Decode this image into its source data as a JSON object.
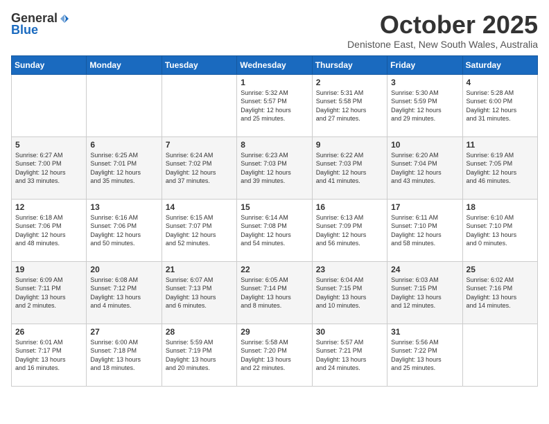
{
  "logo": {
    "general": "General",
    "blue": "Blue"
  },
  "title": "October 2025",
  "subtitle": "Denistone East, New South Wales, Australia",
  "days_of_week": [
    "Sunday",
    "Monday",
    "Tuesday",
    "Wednesday",
    "Thursday",
    "Friday",
    "Saturday"
  ],
  "weeks": [
    [
      {
        "day": "",
        "info": ""
      },
      {
        "day": "",
        "info": ""
      },
      {
        "day": "",
        "info": ""
      },
      {
        "day": "1",
        "info": "Sunrise: 5:32 AM\nSunset: 5:57 PM\nDaylight: 12 hours\nand 25 minutes."
      },
      {
        "day": "2",
        "info": "Sunrise: 5:31 AM\nSunset: 5:58 PM\nDaylight: 12 hours\nand 27 minutes."
      },
      {
        "day": "3",
        "info": "Sunrise: 5:30 AM\nSunset: 5:59 PM\nDaylight: 12 hours\nand 29 minutes."
      },
      {
        "day": "4",
        "info": "Sunrise: 5:28 AM\nSunset: 6:00 PM\nDaylight: 12 hours\nand 31 minutes."
      }
    ],
    [
      {
        "day": "5",
        "info": "Sunrise: 6:27 AM\nSunset: 7:00 PM\nDaylight: 12 hours\nand 33 minutes."
      },
      {
        "day": "6",
        "info": "Sunrise: 6:25 AM\nSunset: 7:01 PM\nDaylight: 12 hours\nand 35 minutes."
      },
      {
        "day": "7",
        "info": "Sunrise: 6:24 AM\nSunset: 7:02 PM\nDaylight: 12 hours\nand 37 minutes."
      },
      {
        "day": "8",
        "info": "Sunrise: 6:23 AM\nSunset: 7:03 PM\nDaylight: 12 hours\nand 39 minutes."
      },
      {
        "day": "9",
        "info": "Sunrise: 6:22 AM\nSunset: 7:03 PM\nDaylight: 12 hours\nand 41 minutes."
      },
      {
        "day": "10",
        "info": "Sunrise: 6:20 AM\nSunset: 7:04 PM\nDaylight: 12 hours\nand 43 minutes."
      },
      {
        "day": "11",
        "info": "Sunrise: 6:19 AM\nSunset: 7:05 PM\nDaylight: 12 hours\nand 46 minutes."
      }
    ],
    [
      {
        "day": "12",
        "info": "Sunrise: 6:18 AM\nSunset: 7:06 PM\nDaylight: 12 hours\nand 48 minutes."
      },
      {
        "day": "13",
        "info": "Sunrise: 6:16 AM\nSunset: 7:06 PM\nDaylight: 12 hours\nand 50 minutes."
      },
      {
        "day": "14",
        "info": "Sunrise: 6:15 AM\nSunset: 7:07 PM\nDaylight: 12 hours\nand 52 minutes."
      },
      {
        "day": "15",
        "info": "Sunrise: 6:14 AM\nSunset: 7:08 PM\nDaylight: 12 hours\nand 54 minutes."
      },
      {
        "day": "16",
        "info": "Sunrise: 6:13 AM\nSunset: 7:09 PM\nDaylight: 12 hours\nand 56 minutes."
      },
      {
        "day": "17",
        "info": "Sunrise: 6:11 AM\nSunset: 7:10 PM\nDaylight: 12 hours\nand 58 minutes."
      },
      {
        "day": "18",
        "info": "Sunrise: 6:10 AM\nSunset: 7:10 PM\nDaylight: 13 hours\nand 0 minutes."
      }
    ],
    [
      {
        "day": "19",
        "info": "Sunrise: 6:09 AM\nSunset: 7:11 PM\nDaylight: 13 hours\nand 2 minutes."
      },
      {
        "day": "20",
        "info": "Sunrise: 6:08 AM\nSunset: 7:12 PM\nDaylight: 13 hours\nand 4 minutes."
      },
      {
        "day": "21",
        "info": "Sunrise: 6:07 AM\nSunset: 7:13 PM\nDaylight: 13 hours\nand 6 minutes."
      },
      {
        "day": "22",
        "info": "Sunrise: 6:05 AM\nSunset: 7:14 PM\nDaylight: 13 hours\nand 8 minutes."
      },
      {
        "day": "23",
        "info": "Sunrise: 6:04 AM\nSunset: 7:15 PM\nDaylight: 13 hours\nand 10 minutes."
      },
      {
        "day": "24",
        "info": "Sunrise: 6:03 AM\nSunset: 7:15 PM\nDaylight: 13 hours\nand 12 minutes."
      },
      {
        "day": "25",
        "info": "Sunrise: 6:02 AM\nSunset: 7:16 PM\nDaylight: 13 hours\nand 14 minutes."
      }
    ],
    [
      {
        "day": "26",
        "info": "Sunrise: 6:01 AM\nSunset: 7:17 PM\nDaylight: 13 hours\nand 16 minutes."
      },
      {
        "day": "27",
        "info": "Sunrise: 6:00 AM\nSunset: 7:18 PM\nDaylight: 13 hours\nand 18 minutes."
      },
      {
        "day": "28",
        "info": "Sunrise: 5:59 AM\nSunset: 7:19 PM\nDaylight: 13 hours\nand 20 minutes."
      },
      {
        "day": "29",
        "info": "Sunrise: 5:58 AM\nSunset: 7:20 PM\nDaylight: 13 hours\nand 22 minutes."
      },
      {
        "day": "30",
        "info": "Sunrise: 5:57 AM\nSunset: 7:21 PM\nDaylight: 13 hours\nand 24 minutes."
      },
      {
        "day": "31",
        "info": "Sunrise: 5:56 AM\nSunset: 7:22 PM\nDaylight: 13 hours\nand 25 minutes."
      },
      {
        "day": "",
        "info": ""
      }
    ]
  ]
}
